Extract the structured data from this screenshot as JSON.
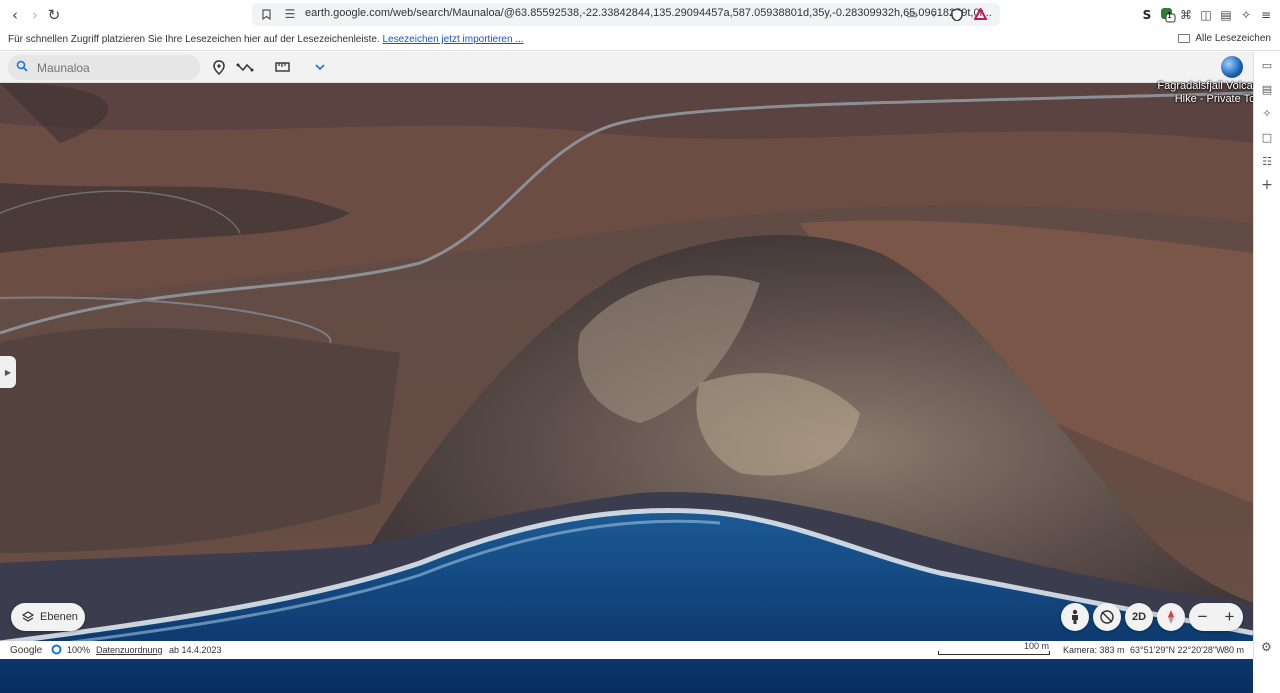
{
  "browser": {
    "url": "earth.google.com/web/search/Maunaloa/@63.85592538,-22.33842844,135.29094457a,587.05938801d,35y,-0.28309932h,65.09618259t,0r...",
    "extension_badge": "1",
    "bookmarks_hint": "Für schnellen Zugriff platzieren Sie Ihre Lesezeichen hier auf der Lesezeichenleiste.",
    "bookmarks_import": "Lesezeichen jetzt importieren ...",
    "all_bookmarks": "Alle Lesezeichen"
  },
  "earth": {
    "search": {
      "placeholder": "Maunaloa"
    },
    "poi": {
      "line1": "Fagradalsfjall Volcano",
      "line2": "Hike - Private Tour"
    },
    "layers_label": "Ebenen",
    "view_2d_label": "2D",
    "zoom_out": "−",
    "zoom_in": "+",
    "status": {
      "brand": "Google",
      "zoom": "100%",
      "attribution": "Datenzuordnung",
      "date": "ab 14.4.2023",
      "scale": "100 m",
      "camera": "Kamera: 383 m",
      "coords": "63°51'29\"N 22°20'28\"W",
      "elevation": "80 m"
    }
  },
  "colors": {
    "accent": "#1a73e8",
    "ocean": "#0b3d7a",
    "terrain": "#6b4a3e"
  },
  "icons": [
    "back-icon",
    "forward-icon",
    "reload-icon",
    "bookmark-icon",
    "search-icon",
    "placemark-icon",
    "path-icon",
    "ruler-icon",
    "chevron-down-icon",
    "globe-icon",
    "layers-icon",
    "pegman-icon",
    "compass-icon",
    "settings-icon"
  ]
}
